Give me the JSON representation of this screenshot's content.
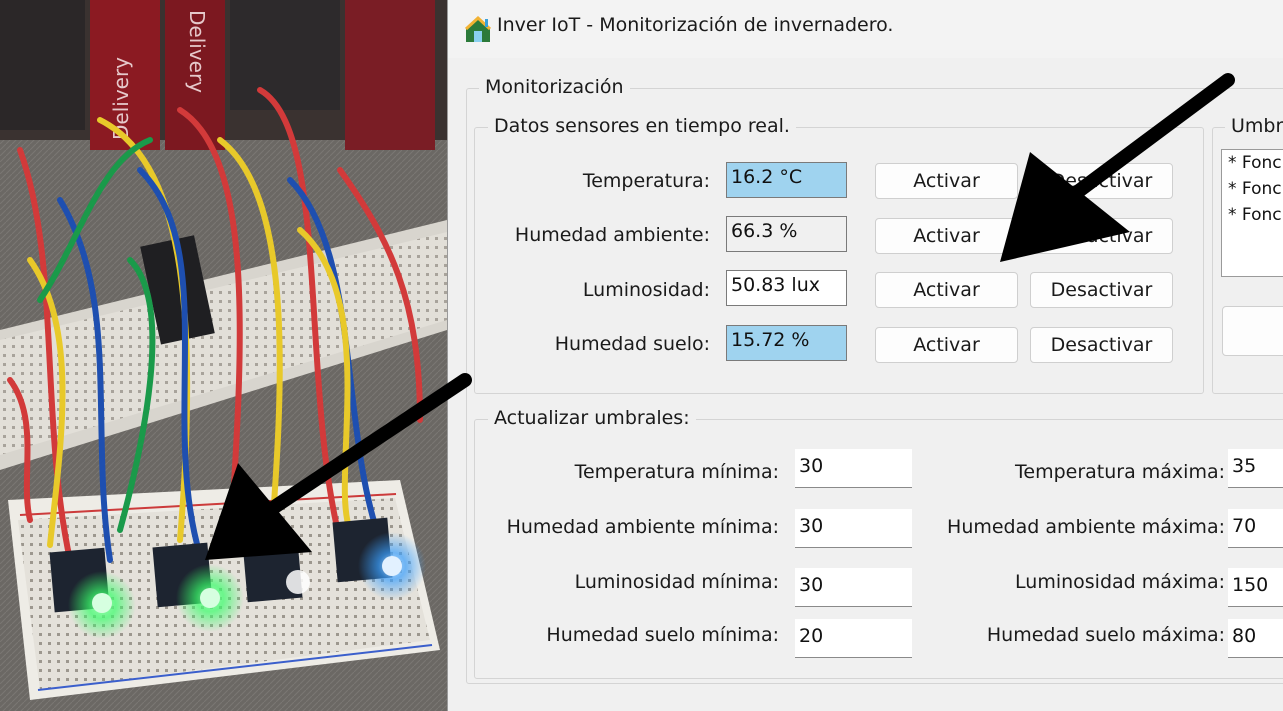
{
  "window": {
    "title": "Inver IoT - Monitorización de invernadero."
  },
  "monitor": {
    "legend": "Monitorización"
  },
  "sensors": {
    "legend": "Datos sensores en tiempo real.",
    "rows": [
      {
        "label": "Temperatura:",
        "value": "16.2 °C",
        "color": "#9fd3ef",
        "activate": "Activar",
        "deactivate": "Desactivar"
      },
      {
        "label": "Humedad ambiente:",
        "value": "66.3 %",
        "color": "#f0f0f0",
        "activate": "Activar",
        "deactivate": "Desactivar"
      },
      {
        "label": "Luminosidad:",
        "value": "50.83 lux",
        "color": "#ffffff",
        "activate": "Activar",
        "deactivate": "Desactivar"
      },
      {
        "label": "Humedad suelo:",
        "value": "15.72 %",
        "color": "#9fd3ef",
        "activate": "Activar",
        "deactivate": "Desactivar"
      }
    ]
  },
  "thresholds_panel": {
    "legend": "Umbr",
    "items": [
      "* Fonc",
      "* Fonc",
      "* Fonc"
    ]
  },
  "update": {
    "legend": "Actualizar umbrales:",
    "rows": [
      {
        "min_label": "Temperatura mínima:",
        "min_value": "30",
        "max_label": "Temperatura máxima:",
        "max_value": "35"
      },
      {
        "min_label": "Humedad ambiente mínima:",
        "min_value": "30",
        "max_label": "Humedad ambiente máxima:",
        "max_value": "70"
      },
      {
        "min_label": "Luminosidad mínima:",
        "min_value": "30",
        "max_label": "Luminosidad máxima:",
        "max_value": "150"
      },
      {
        "min_label": "Humedad suelo mínima:",
        "min_value": "20",
        "max_label": "Humedad suelo máxima:",
        "max_value": "80"
      }
    ]
  },
  "photo": {
    "labels": [
      "Delivery",
      "Delivery"
    ]
  },
  "colors": {
    "highlight": "#9fd3ef",
    "arrow": "#000000",
    "led_green": "#38ff6a",
    "led_blue": "#3aa0ff"
  }
}
